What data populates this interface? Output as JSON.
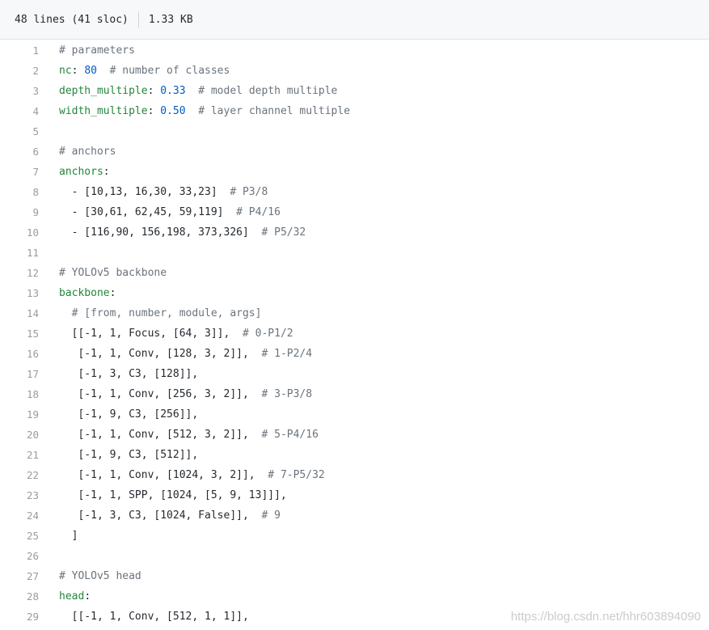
{
  "header": {
    "lines_info": "48 lines (41 sloc)",
    "size": "1.33 KB"
  },
  "lines": [
    {
      "n": "1",
      "tokens": [
        {
          "t": "# parameters",
          "c": "c"
        }
      ]
    },
    {
      "n": "2",
      "tokens": [
        {
          "t": "nc",
          "c": "k"
        },
        {
          "t": ": ",
          "c": "p"
        },
        {
          "t": "80",
          "c": "n"
        },
        {
          "t": "  # number of classes",
          "c": "c"
        }
      ]
    },
    {
      "n": "3",
      "tokens": [
        {
          "t": "depth_multiple",
          "c": "k"
        },
        {
          "t": ": ",
          "c": "p"
        },
        {
          "t": "0.33",
          "c": "n"
        },
        {
          "t": "  # model depth multiple",
          "c": "c"
        }
      ]
    },
    {
      "n": "4",
      "tokens": [
        {
          "t": "width_multiple",
          "c": "k"
        },
        {
          "t": ": ",
          "c": "p"
        },
        {
          "t": "0.50",
          "c": "n"
        },
        {
          "t": "  # layer channel multiple",
          "c": "c"
        }
      ]
    },
    {
      "n": "5",
      "tokens": []
    },
    {
      "n": "6",
      "tokens": [
        {
          "t": "# anchors",
          "c": "c"
        }
      ]
    },
    {
      "n": "7",
      "tokens": [
        {
          "t": "anchors",
          "c": "k"
        },
        {
          "t": ":",
          "c": "p"
        }
      ]
    },
    {
      "n": "8",
      "tokens": [
        {
          "t": "  - [10,13, 16,30, 33,23]",
          "c": "p"
        },
        {
          "t": "  # P3/8",
          "c": "c"
        }
      ]
    },
    {
      "n": "9",
      "tokens": [
        {
          "t": "  - [30,61, 62,45, 59,119]",
          "c": "p"
        },
        {
          "t": "  # P4/16",
          "c": "c"
        }
      ]
    },
    {
      "n": "10",
      "tokens": [
        {
          "t": "  - [116,90, 156,198, 373,326]",
          "c": "p"
        },
        {
          "t": "  # P5/32",
          "c": "c"
        }
      ]
    },
    {
      "n": "11",
      "tokens": []
    },
    {
      "n": "12",
      "tokens": [
        {
          "t": "# YOLOv5 backbone",
          "c": "c"
        }
      ]
    },
    {
      "n": "13",
      "tokens": [
        {
          "t": "backbone",
          "c": "k"
        },
        {
          "t": ":",
          "c": "p"
        }
      ]
    },
    {
      "n": "14",
      "tokens": [
        {
          "t": "  # [from, number, module, args]",
          "c": "c"
        }
      ]
    },
    {
      "n": "15",
      "tokens": [
        {
          "t": "  [[-1, 1, Focus, [64, 3]],",
          "c": "p"
        },
        {
          "t": "  # 0-P1/2",
          "c": "c"
        }
      ]
    },
    {
      "n": "16",
      "tokens": [
        {
          "t": "   [-1, 1, Conv, [128, 3, 2]],",
          "c": "p"
        },
        {
          "t": "  # 1-P2/4",
          "c": "c"
        }
      ]
    },
    {
      "n": "17",
      "tokens": [
        {
          "t": "   [-1, 3, C3, [128]],",
          "c": "p"
        }
      ]
    },
    {
      "n": "18",
      "tokens": [
        {
          "t": "   [-1, 1, Conv, [256, 3, 2]],",
          "c": "p"
        },
        {
          "t": "  # 3-P3/8",
          "c": "c"
        }
      ]
    },
    {
      "n": "19",
      "tokens": [
        {
          "t": "   [-1, 9, C3, [256]],",
          "c": "p"
        }
      ]
    },
    {
      "n": "20",
      "tokens": [
        {
          "t": "   [-1, 1, Conv, [512, 3, 2]],",
          "c": "p"
        },
        {
          "t": "  # 5-P4/16",
          "c": "c"
        }
      ]
    },
    {
      "n": "21",
      "tokens": [
        {
          "t": "   [-1, 9, C3, [512]],",
          "c": "p"
        }
      ]
    },
    {
      "n": "22",
      "tokens": [
        {
          "t": "   [-1, 1, Conv, [1024, 3, 2]],",
          "c": "p"
        },
        {
          "t": "  # 7-P5/32",
          "c": "c"
        }
      ]
    },
    {
      "n": "23",
      "tokens": [
        {
          "t": "   [-1, 1, SPP, [1024, [5, 9, 13]]],",
          "c": "p"
        }
      ]
    },
    {
      "n": "24",
      "tokens": [
        {
          "t": "   [-1, 3, C3, [1024, False]],",
          "c": "p"
        },
        {
          "t": "  # 9",
          "c": "c"
        }
      ]
    },
    {
      "n": "25",
      "tokens": [
        {
          "t": "  ]",
          "c": "p"
        }
      ]
    },
    {
      "n": "26",
      "tokens": []
    },
    {
      "n": "27",
      "tokens": [
        {
          "t": "# YOLOv5 head",
          "c": "c"
        }
      ]
    },
    {
      "n": "28",
      "tokens": [
        {
          "t": "head",
          "c": "k"
        },
        {
          "t": ":",
          "c": "p"
        }
      ]
    },
    {
      "n": "29",
      "tokens": [
        {
          "t": "  [[-1, 1, Conv, [512, 1, 1]],",
          "c": "p"
        }
      ]
    }
  ],
  "watermark": "https://blog.csdn.net/hhr603894090"
}
